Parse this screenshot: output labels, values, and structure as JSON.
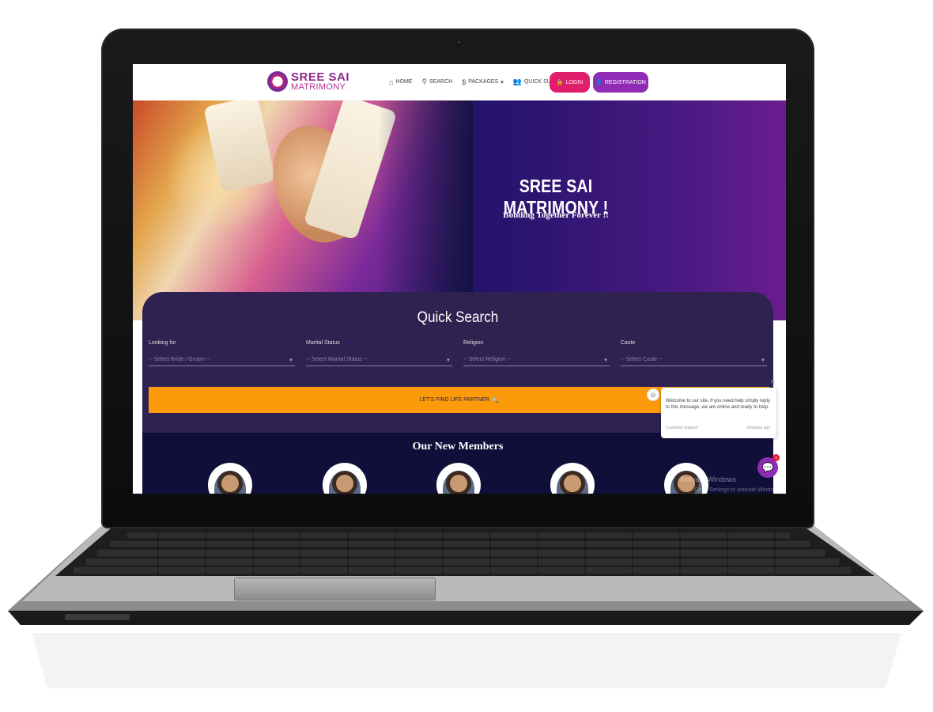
{
  "brand": {
    "line1": "SREE SAI",
    "line2": "MATRIMONY"
  },
  "nav": {
    "home": "HOME",
    "search": "SEARCH",
    "packages": "PACKAGES",
    "support": "QUICK SUPPORT",
    "login": "LOGIN",
    "registration": "REGISTRATION"
  },
  "hero": {
    "title": "SREE SAI MATRIMONY !",
    "subtitle": "Bonding Together Forever !!"
  },
  "quick_search": {
    "title": "Quick Search",
    "fields": [
      {
        "label": "Looking for",
        "placeholder": "-- Select Bride / Groom --"
      },
      {
        "label": "Marital Status",
        "placeholder": "-- Select Marital Status --"
      },
      {
        "label": "Religion",
        "placeholder": "-- Select Religion --"
      },
      {
        "label": "Caste",
        "placeholder": "-- Select Caste --"
      }
    ],
    "button": "LET'S FIND LIFE PARTNER"
  },
  "members": {
    "title": "Our New Members"
  },
  "chat": {
    "message": "Welcome to our site, if you need help simply reply to this message, we are online and ready to help.",
    "agent": "Customer Support",
    "time": "2minutes ago",
    "badge": "1"
  },
  "watermark": {
    "line1": "Activate Windows",
    "line2": "Go to Settings to activate Windows."
  },
  "colors": {
    "login": "#e11e6b",
    "registration": "#8f2bb5",
    "find_button": "#fb9a0b",
    "panel": "#2f2250",
    "members_bg": "#100f3a"
  }
}
